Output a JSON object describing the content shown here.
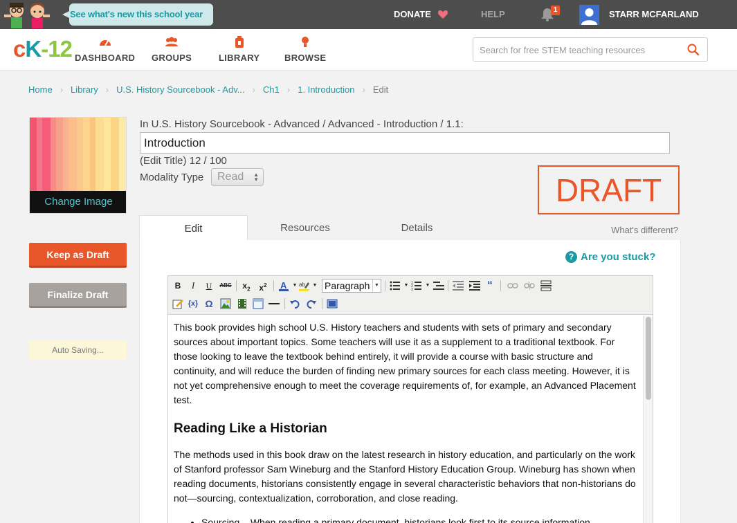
{
  "topbar": {
    "whats_new": "See what's new this school year",
    "donate": "DONATE",
    "help": "HELP",
    "notifications_count": "1",
    "user_name": "STARR MCFARLAND"
  },
  "nav": {
    "logo_c": "c",
    "logo_k": "K",
    "logo_12": "-12",
    "items": [
      {
        "label": "DASHBOARD",
        "icon": "dashboard-icon"
      },
      {
        "label": "GROUPS",
        "icon": "groups-icon"
      },
      {
        "label": "LIBRARY",
        "icon": "library-icon"
      },
      {
        "label": "BROWSE",
        "icon": "browse-icon"
      }
    ],
    "search_placeholder": "Search for free STEM teaching resources"
  },
  "breadcrumb": {
    "items": [
      "Home",
      "Library",
      "U.S. History Sourcebook - Adv...",
      "Ch1",
      "1. Introduction"
    ],
    "current": "Edit"
  },
  "sidebar": {
    "change_image": "Change Image",
    "keep_draft": "Keep as Draft",
    "finalize": "Finalize Draft",
    "auto_saving": "Auto Saving..."
  },
  "header": {
    "path_label": "In U.S. History Sourcebook - Advanced / Advanced - Introduction / 1.1:",
    "title_value": "Introduction",
    "title_count": "(Edit Title) 12 / 100",
    "modality_label": "Modality Type",
    "modality_value": "Read",
    "draft_stamp": "DRAFT"
  },
  "tabs": {
    "items": [
      "Edit",
      "Resources",
      "Details"
    ],
    "active": "Edit",
    "whats_different": "What's different?"
  },
  "help": {
    "are_you_stuck": "Are you stuck?"
  },
  "editor": {
    "format_value": "Paragraph",
    "p1": "This book provides high school U.S. History teachers and students with sets of primary and secondary sources about important topics. Some teachers will use it as a supplement to a traditional textbook. For those looking to leave the textbook behind entirely, it will provide a course with basic structure and continuity, and will reduce the burden of finding new primary sources for each class meeting. However, it is not yet comprehensive enough to meet the coverage requirements of, for example, an Advanced Placement test.",
    "h2": "Reading Like a Historian",
    "p2": "The methods used in this book draw on the latest research in history education, and particularly on the work of Stanford professor Sam Wineburg and the Stanford History Education Group. Wineburg has shown when reading documents, historians consistently engage in several characteristic behaviors that non-historians do not—sourcing, contextualization, corroboration, and close reading.",
    "li1": "Sourcing – When reading a primary document, historians look first to its source information."
  },
  "colors": {
    "accent_orange": "#e8562a",
    "accent_teal": "#1a9aa5",
    "topbar": "#4d4d4d"
  }
}
